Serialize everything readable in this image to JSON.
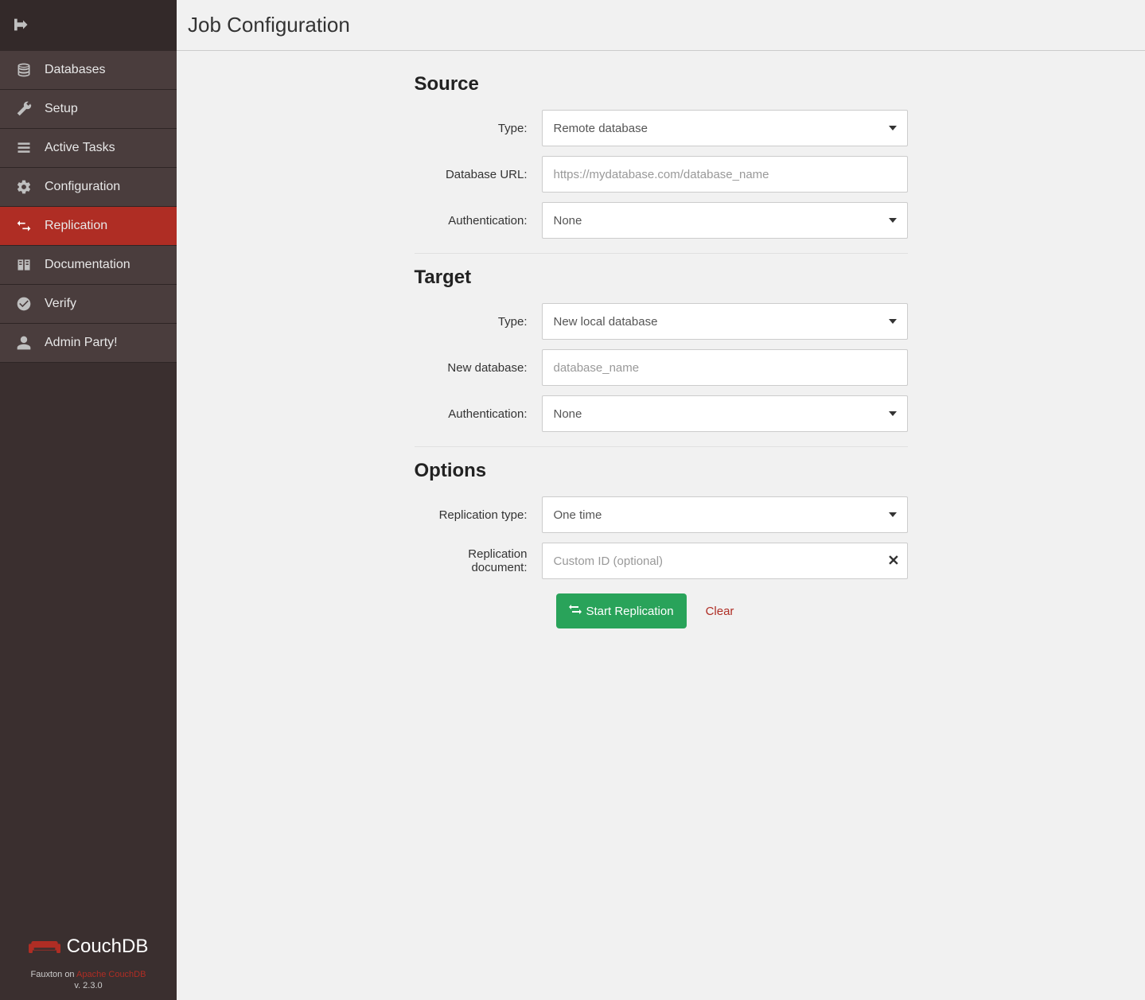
{
  "header": {
    "title": "Job Configuration"
  },
  "sidebar": {
    "items": [
      {
        "id": "databases",
        "label": "Databases"
      },
      {
        "id": "setup",
        "label": "Setup"
      },
      {
        "id": "active-tasks",
        "label": "Active Tasks"
      },
      {
        "id": "configuration",
        "label": "Configuration"
      },
      {
        "id": "replication",
        "label": "Replication"
      },
      {
        "id": "documentation",
        "label": "Documentation"
      },
      {
        "id": "verify",
        "label": "Verify"
      },
      {
        "id": "admin-party",
        "label": "Admin Party!"
      }
    ]
  },
  "footer": {
    "logo_text": "CouchDB",
    "line_prefix": "Fauxton on ",
    "line_link": "Apache CouchDB",
    "version": "v. 2.3.0"
  },
  "sections": {
    "source": {
      "title": "Source",
      "type_label": "Type:",
      "type_value": "Remote database",
      "url_label": "Database URL:",
      "url_placeholder": "https://mydatabase.com/database_name",
      "auth_label": "Authentication:",
      "auth_value": "None"
    },
    "target": {
      "title": "Target",
      "type_label": "Type:",
      "type_value": "New local database",
      "name_label": "New database:",
      "name_placeholder": "database_name",
      "auth_label": "Authentication:",
      "auth_value": "None"
    },
    "options": {
      "title": "Options",
      "reptype_label": "Replication type:",
      "reptype_value": "One time",
      "repdoc_label": "Replication document:",
      "repdoc_placeholder": "Custom ID (optional)"
    }
  },
  "actions": {
    "start_label": "Start Replication",
    "clear_label": "Clear"
  }
}
